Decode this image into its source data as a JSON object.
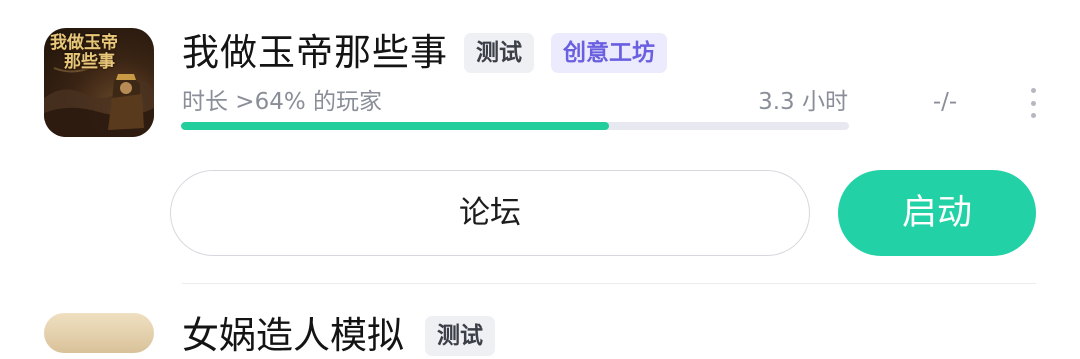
{
  "game": {
    "icon_text_line1": "我做玉帝",
    "icon_text_line2": "那些事",
    "title": "我做玉帝那些事",
    "tags": [
      "测试",
      "创意工坊"
    ],
    "playtime_label": "时长 >64% 的玩家",
    "playtime_hours": "3.3 小时",
    "playtime_progress_percent": 64,
    "rating": "-/-",
    "forum_label": "论坛",
    "launch_label": "启动",
    "more_icon": "more-vertical-icon"
  },
  "next_game": {
    "title": "女娲造人模拟",
    "tag": "测试"
  },
  "colors": {
    "accent": "#22d2a6",
    "progress": "#22cf9c",
    "workshop_tag_text": "#6a5fe0",
    "workshop_tag_bg": "#ebebfd"
  }
}
